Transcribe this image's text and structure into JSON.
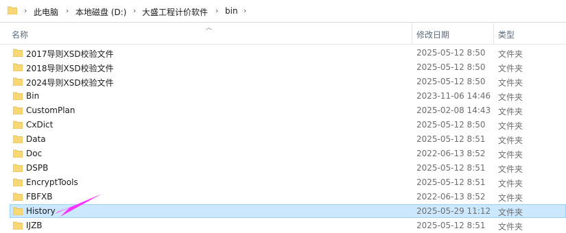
{
  "address_bar": {
    "segments": [
      "此电脑",
      "本地磁盘 (D:)",
      "大盛工程计价软件",
      "bin"
    ]
  },
  "columns": {
    "name": "名称",
    "modified": "修改日期",
    "type": "类型"
  },
  "rows": [
    {
      "name": "2017导则XSD校验文件",
      "date": "2025-05-12 8:50",
      "type": "文件夹"
    },
    {
      "name": "2018导则XSD校验文件",
      "date": "2025-05-12 8:50",
      "type": "文件夹"
    },
    {
      "name": "2024导则XSD校验文件",
      "date": "2025-05-12 8:50",
      "type": "文件夹"
    },
    {
      "name": "Bin",
      "date": "2023-11-06 14:46",
      "type": "文件夹"
    },
    {
      "name": "CustomPlan",
      "date": "2025-02-08 14:43",
      "type": "文件夹"
    },
    {
      "name": "CxDict",
      "date": "2025-05-12 8:50",
      "type": "文件夹"
    },
    {
      "name": "Data",
      "date": "2025-05-12 8:51",
      "type": "文件夹"
    },
    {
      "name": "Doc",
      "date": "2022-06-13 8:52",
      "type": "文件夹"
    },
    {
      "name": "DSPB",
      "date": "2025-05-12 8:51",
      "type": "文件夹"
    },
    {
      "name": "EncryptTools",
      "date": "2025-05-12 8:51",
      "type": "文件夹"
    },
    {
      "name": "FBFXB",
      "date": "2022-06-13 8:52",
      "type": "文件夹"
    },
    {
      "name": "History",
      "date": "2025-05-29 11:12",
      "type": "文件夹",
      "selected": true
    },
    {
      "name": "IJZB",
      "date": "2025-05-12 8:51",
      "type": "文件夹"
    }
  ],
  "colors": {
    "folder": "#f8d775",
    "folder_dark": "#e0b54a",
    "selection_bg": "#cce8ff",
    "selection_border": "#99d1ff",
    "annotation_arrow": "#ff33ff"
  },
  "icons": {
    "folder": "folder-icon",
    "separator": "chevron-right-icon",
    "sort": "sort-ascending-icon"
  }
}
